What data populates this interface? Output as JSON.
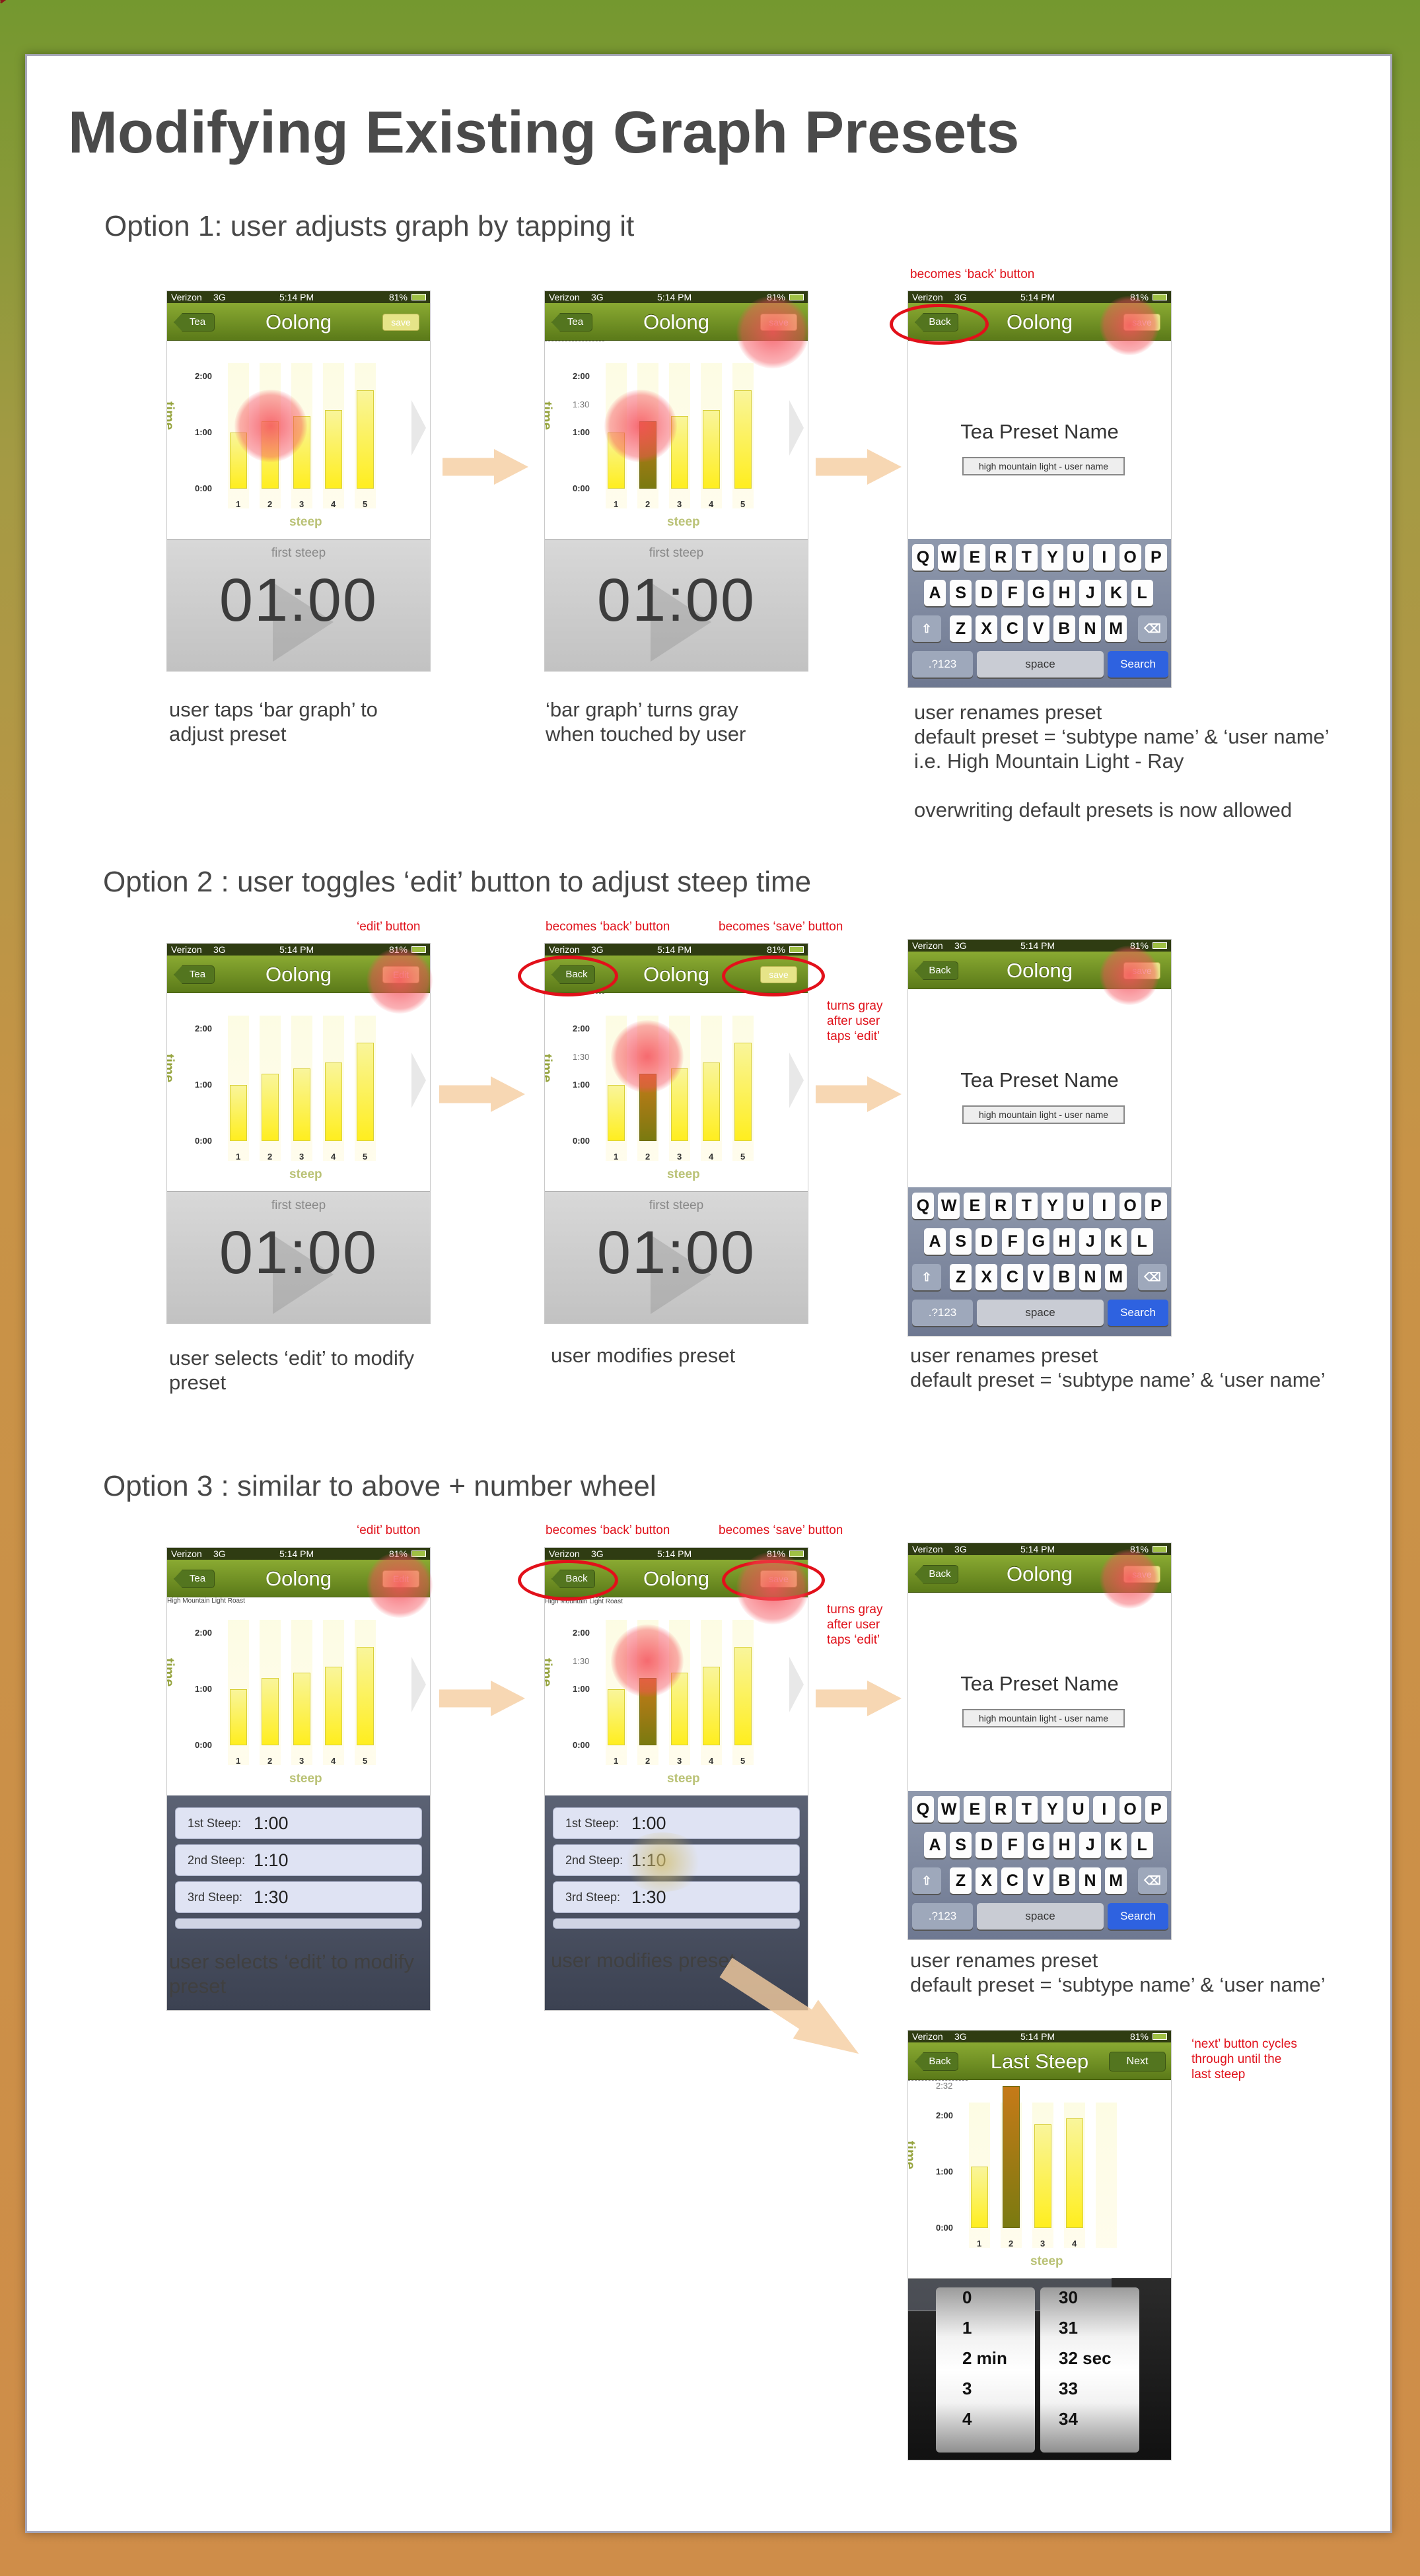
{
  "title": "Modifying Existing Graph Presets",
  "status": {
    "carrier": "Verizon",
    "network": "3G",
    "time": "5:14 PM",
    "battery": "81%"
  },
  "nav": {
    "back_tea": "Tea",
    "back": "Back",
    "title": "Oolong",
    "save": "save",
    "edit": "Edit",
    "last_title": "Last Steep",
    "next": "Next"
  },
  "graph": {
    "y_ticks": [
      "2:00",
      "1:30",
      "1:00",
      "0:00"
    ],
    "y_tick_extra": "2:32",
    "y_title": "time",
    "x_title": "steep",
    "x_labels": [
      "1",
      "2",
      "3",
      "4",
      "5"
    ],
    "preset_label": "High Mountain Light Roast"
  },
  "timer": {
    "label": "first steep",
    "value": "01:00"
  },
  "form": {
    "title": "Tea Preset Name",
    "input": "high mountain light - user name"
  },
  "keyboard": {
    "row1": [
      "Q",
      "W",
      "E",
      "R",
      "T",
      "Y",
      "U",
      "I",
      "O",
      "P"
    ],
    "row2": [
      "A",
      "S",
      "D",
      "F",
      "G",
      "H",
      "J",
      "K",
      "L"
    ],
    "row3": [
      "Z",
      "X",
      "C",
      "V",
      "B",
      "N",
      "M"
    ],
    "shift": "⇧",
    "delete": "⌫",
    "num": ".?123",
    "space": "space",
    "search": "Search"
  },
  "wheel": {
    "rows": [
      {
        "key": "1st Steep:",
        "value": "1:00"
      },
      {
        "key": "2nd Steep:",
        "value": "1:10"
      },
      {
        "key": "3rd Steep:",
        "value": "1:30"
      }
    ]
  },
  "picker": {
    "min": [
      "0",
      "1",
      "2 min",
      "3",
      "4"
    ],
    "sec": [
      "30",
      "31",
      "32 sec",
      "33",
      "34"
    ]
  },
  "sections": {
    "opt1": "Option 1: user adjusts graph by tapping it",
    "opt2": "Option 2 : user toggles ‘edit’ button to adjust steep time",
    "opt3": "Option 3 : similar to above + number wheel"
  },
  "notes": {
    "becomes_back": "becomes ‘back’ button",
    "becomes_save": "becomes ‘save’ button",
    "edit_button": "‘edit’ button",
    "turns_gray": [
      "turns gray",
      "after user",
      "taps ‘edit’"
    ],
    "next_cycles": [
      "‘next’ button cycles",
      "through until the",
      "last steep"
    ]
  },
  "captions": {
    "o1a": [
      "user taps ‘bar graph’ to",
      "adjust preset"
    ],
    "o1b": [
      "‘bar graph’ turns gray",
      "when touched by user"
    ],
    "o1c": [
      "user renames preset",
      "default preset = ‘subtype name’ & ‘user name’",
      "i.e. High Mountain Light - Ray",
      "",
      "overwriting default presets is now allowed"
    ],
    "o2a": [
      "user selects ‘edit’ to modify",
      "preset"
    ],
    "o2b": [
      "user modifies preset"
    ],
    "o2c": [
      "user renames preset",
      "default preset = ‘subtype name’ & ‘user name’"
    ],
    "o3a": [
      "user selects ‘edit’ to modify",
      "preset"
    ],
    "o3b": [
      "user modifies preset"
    ],
    "o3c": [
      "user renames preset",
      "default preset = ‘subtype name’ & ‘user name’"
    ]
  },
  "chart_data": {
    "type": "bar",
    "categories": [
      "1",
      "2",
      "3",
      "4",
      "5"
    ],
    "values": [
      1.0,
      1.2,
      1.3,
      1.4,
      1.75
    ],
    "ylim": [
      0,
      2
    ],
    "ylabel": "time",
    "xlabel": "steep"
  }
}
